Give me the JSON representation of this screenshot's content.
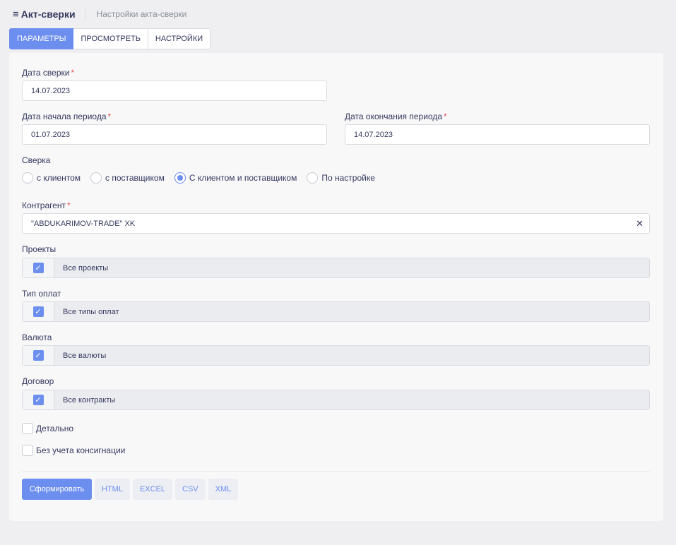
{
  "header": {
    "title": "Акт-сверки",
    "subtitle": "Настройки акта-сверки"
  },
  "tabs": [
    {
      "label": "ПАРАМЕТРЫ",
      "active": true
    },
    {
      "label": "ПРОСМОТРЕТЬ",
      "active": false
    },
    {
      "label": "НАСТРОЙКИ",
      "active": false
    }
  ],
  "form": {
    "reconcile_date": {
      "label": "Дата сверки",
      "value": "14.07.2023"
    },
    "period_start": {
      "label": "Дата начала периода",
      "value": "01.07.2023"
    },
    "period_end": {
      "label": "Дата окончания периода",
      "value": "14.07.2023"
    },
    "reconcile_type": {
      "label": "Сверка",
      "options": [
        "с клиентом",
        "с поставщиком",
        "С клиентом и поставщиком",
        "По настройке"
      ],
      "selected": "С клиентом и поставщиком"
    },
    "counterparty": {
      "label": "Контрагент",
      "value": "\"ABDUKARIMOV-TRADE\" XK"
    },
    "projects": {
      "label": "Проекты",
      "text": "Все проекты",
      "checked": true
    },
    "payment_types": {
      "label": "Тип оплат",
      "text": "Все типы оплат",
      "checked": true
    },
    "currency": {
      "label": "Валюта",
      "text": "Все валюты",
      "checked": true
    },
    "contract": {
      "label": "Договор",
      "text": "Все контракты",
      "checked": true
    },
    "detailed": {
      "label": "Детально",
      "checked": false
    },
    "no_consignment": {
      "label": "Без учета консигнации",
      "checked": false
    },
    "required_mark": "*"
  },
  "actions": {
    "generate": "Сформировать",
    "html": "HTML",
    "excel": "EXCEL",
    "csv": "CSV",
    "xml": "XML"
  },
  "colors": {
    "accent": "#6c8eef",
    "required": "#e2504c"
  },
  "icons": {
    "menu": "hamburger-icon",
    "clear": "close-icon",
    "check": "checkmark-icon"
  }
}
